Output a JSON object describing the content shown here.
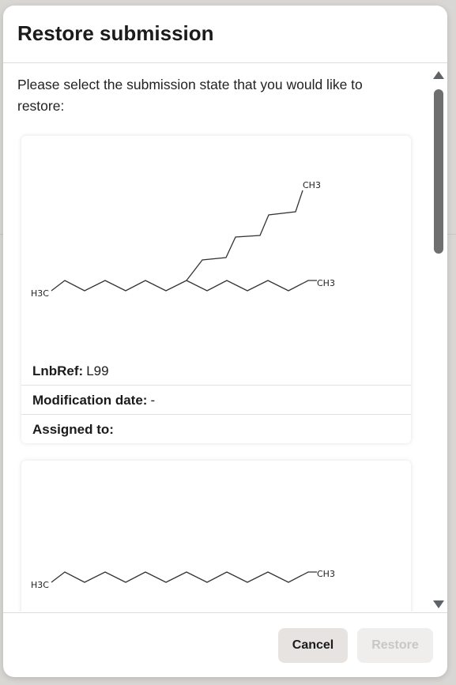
{
  "dialog": {
    "title": "Restore submission",
    "description": "Please select the submission state that you would like to restore:"
  },
  "submissions": [
    {
      "structure_labels": {
        "start": "H3C",
        "branch_end": "CH3",
        "main_end": "CH3"
      },
      "lnbref_label": "LnbRef:",
      "lnbref_value": "L99",
      "modification_label": "Modification date:",
      "modification_value": "-",
      "assigned_label": "Assigned to:",
      "assigned_value": ""
    },
    {
      "structure_labels": {
        "start": "H3C",
        "main_end": "CH3"
      }
    }
  ],
  "footer": {
    "cancel_label": "Cancel",
    "restore_label": "Restore"
  }
}
